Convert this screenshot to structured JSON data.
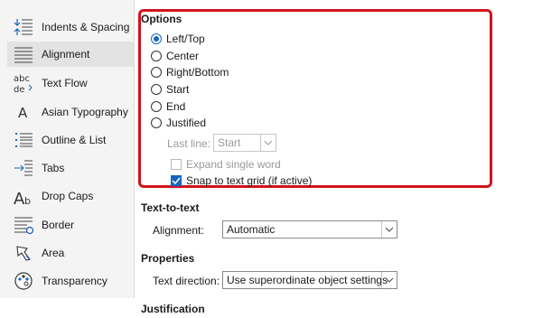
{
  "sidebar": {
    "items": [
      {
        "label": "Indents & Spacing",
        "icon": "indents-spacing-icon"
      },
      {
        "label": "Alignment",
        "icon": "alignment-icon",
        "selected": true
      },
      {
        "label": "Text Flow",
        "icon": "text-flow-icon"
      },
      {
        "label": "Asian Typography",
        "icon": "asian-typography-icon"
      },
      {
        "label": "Outline & List",
        "icon": "outline-list-icon"
      },
      {
        "label": "Tabs",
        "icon": "tabs-icon"
      },
      {
        "label": "Drop Caps",
        "icon": "drop-caps-icon"
      },
      {
        "label": "Border",
        "icon": "border-icon"
      },
      {
        "label": "Area",
        "icon": "area-icon"
      },
      {
        "label": "Transparency",
        "icon": "transparency-icon"
      }
    ]
  },
  "options": {
    "title": "Options",
    "radios": [
      "Left/Top",
      "Center",
      "Right/Bottom",
      "Start",
      "End",
      "Justified"
    ],
    "selected": "Left/Top",
    "last_line_label": "Last line:",
    "last_line_value": "Start",
    "expand_single_word": "Expand single word",
    "snap_to_grid": "Snap to text grid (if active)",
    "snap_checked": true
  },
  "text_to_text": {
    "title": "Text-to-text",
    "alignment_label": "Alignment:",
    "alignment_value": "Automatic"
  },
  "properties": {
    "title": "Properties",
    "direction_label": "Text direction:",
    "direction_value": "Use superordinate object settings"
  },
  "justification": {
    "title": "Justification"
  },
  "colors": {
    "highlight": "#d0141c",
    "accent": "#1565c0"
  }
}
